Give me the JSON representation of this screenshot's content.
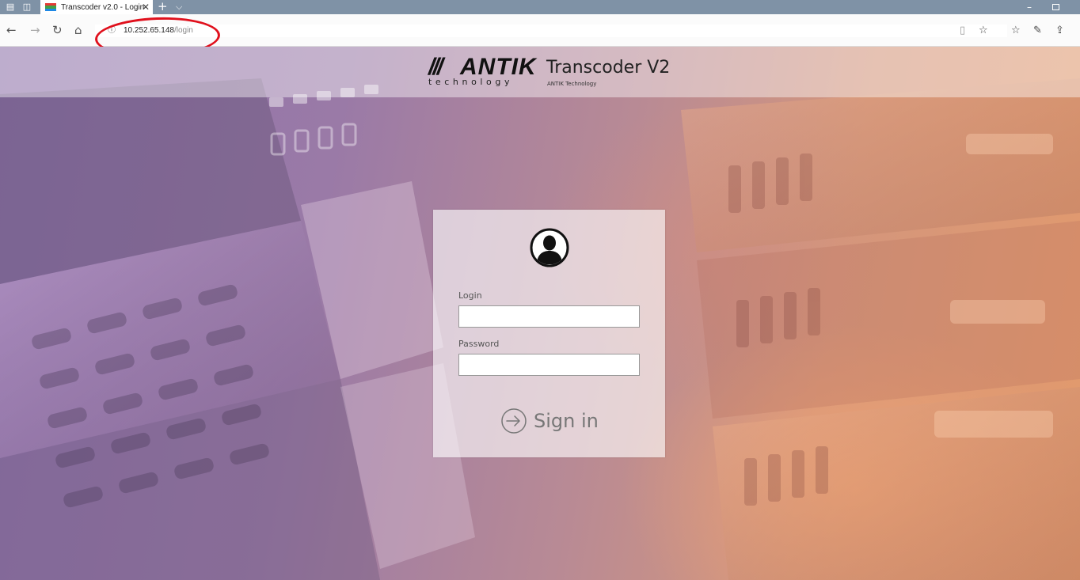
{
  "browser": {
    "tab": {
      "title": "Transcoder v2.0 - Login",
      "close_glyph": "✕",
      "favicon_colors": [
        "#e53935",
        "#43a047",
        "#1e88e5"
      ]
    },
    "new_tab_glyph": "+",
    "tab_menu_glyph": "⌵",
    "url": {
      "host": "10.252.65.148",
      "path": "/login",
      "info_glyph": "ⓘ"
    },
    "nav": {
      "back": "←",
      "forward": "→",
      "refresh": "↻",
      "home": "⌂"
    },
    "toolbar": {
      "reading_view": "▯",
      "favorite": "☆",
      "favorites_hub": "☆",
      "notes": "✎",
      "share": "⇪"
    },
    "window": {
      "minimize": "–"
    },
    "annotation_color": "#e0101c"
  },
  "header": {
    "brand": "ANTIK",
    "brand_sub": "technology",
    "app_title": "Transcoder V2",
    "app_subtitle": "ANTIK Technology"
  },
  "login": {
    "login_label": "Login",
    "login_value": "",
    "password_label": "Password",
    "password_value": "",
    "signin_label": "Sign in"
  }
}
